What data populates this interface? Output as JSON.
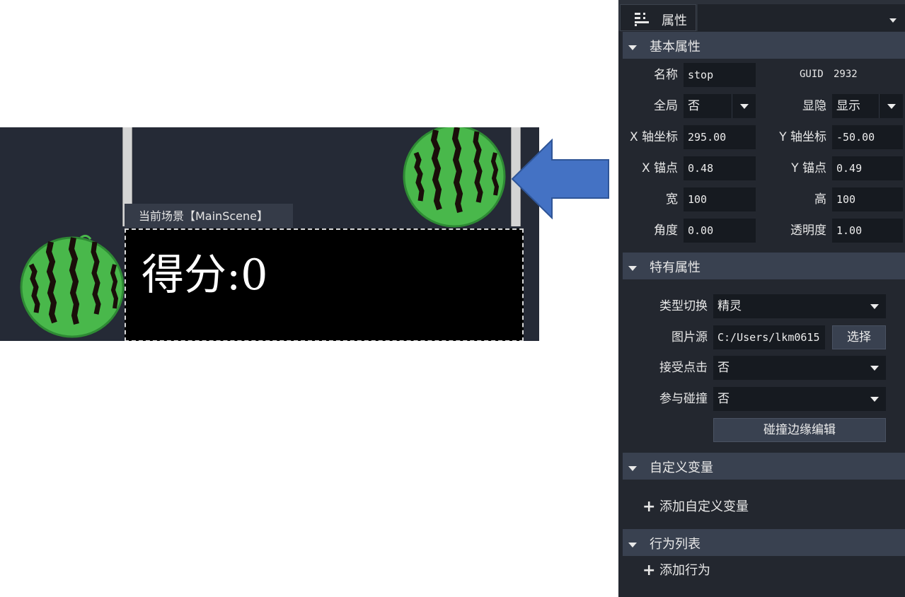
{
  "scene": {
    "tab_label": "当前场景【MainScene】",
    "score_text": "得分:0"
  },
  "panel": {
    "header_title": "属性",
    "sections": {
      "basic": "基本属性",
      "special": "特有属性",
      "custom_vars": "自定义变量",
      "behaviors": "行为列表"
    },
    "basic": {
      "name_label": "名称",
      "name_value": "stop",
      "guid_label": "GUID",
      "guid_value": "2932",
      "global_label": "全局",
      "global_value": "否",
      "visibility_label": "显隐",
      "visibility_value": "显示",
      "x_label": "X 轴坐标",
      "x_value": "295.00",
      "y_label": "Y 轴坐标",
      "y_value": "-50.00",
      "x_anchor_label": "X 锚点",
      "x_anchor_value": "0.48",
      "y_anchor_label": "Y 锚点",
      "y_anchor_value": "0.49",
      "width_label": "宽",
      "width_value": "100",
      "height_label": "高",
      "height_value": "100",
      "angle_label": "角度",
      "angle_value": "0.00",
      "opacity_label": "透明度",
      "opacity_value": "1.00"
    },
    "special": {
      "type_label": "类型切换",
      "type_value": "精灵",
      "image_label": "图片源",
      "image_value": "C:/Users/lkm0615",
      "select_button": "选择",
      "click_label": "接受点击",
      "click_value": "否",
      "collide_label": "参与碰撞",
      "collide_value": "否",
      "edge_edit_button": "碰撞边缘编辑"
    },
    "add_custom_var": "添加自定义变量",
    "add_behavior": "添加行为"
  },
  "colors": {
    "scene_bg": "#252a36",
    "panel_bg": "#23272f",
    "section_bg": "#394150",
    "field_bg": "#161a20",
    "arrow": "#4472c4",
    "melon_green": "#3cb043",
    "melon_stripe": "#1a0e0a"
  }
}
